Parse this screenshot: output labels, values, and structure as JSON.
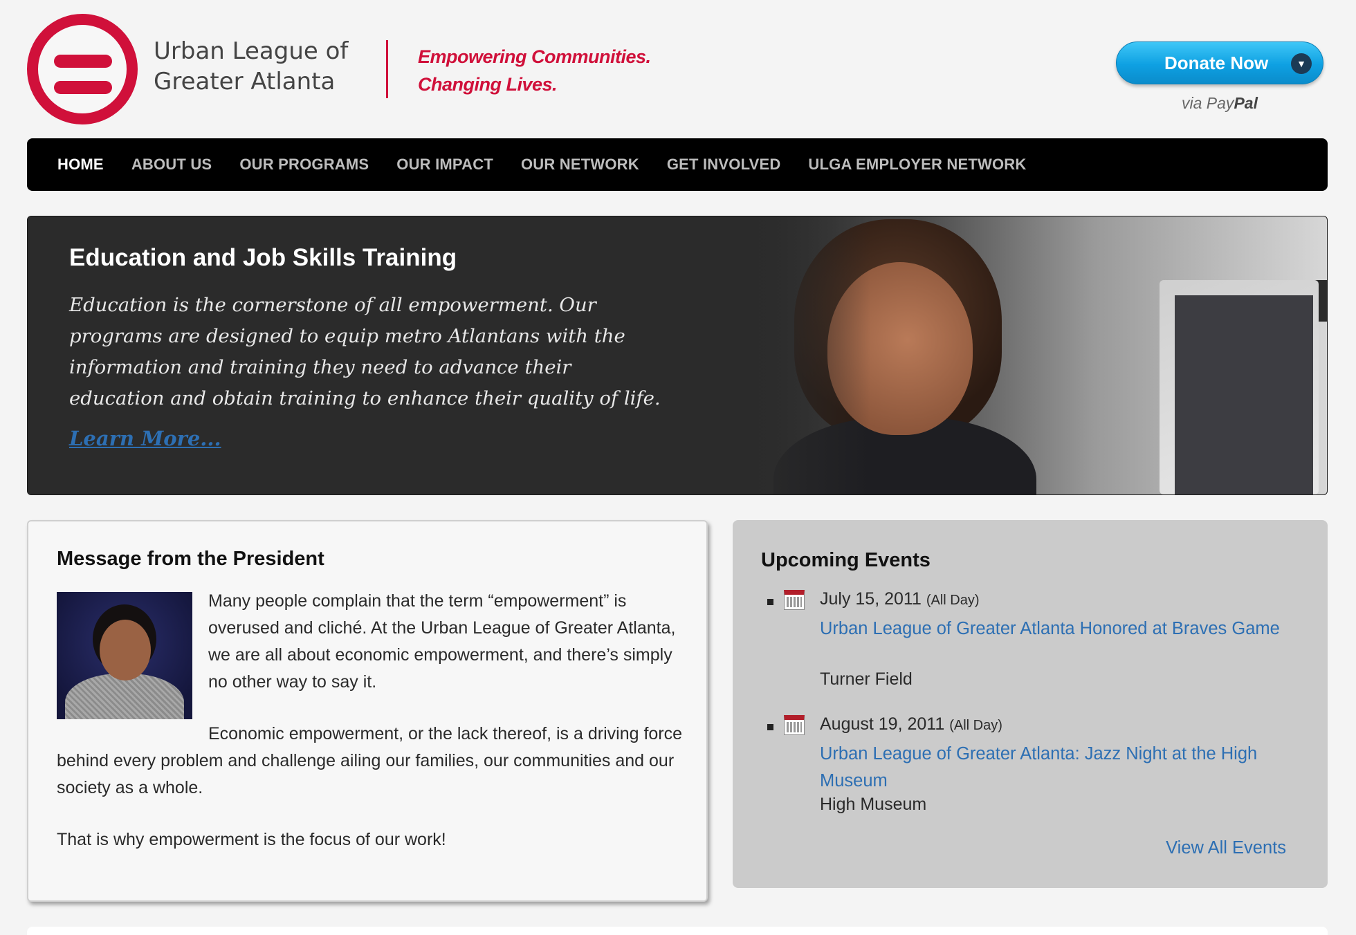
{
  "brand": {
    "name_line1": "Urban League of",
    "name_line2": "Greater Atlanta",
    "tagline_line1": "Empowering Communities.",
    "tagline_line2": "Changing Lives.",
    "color": "#d0103a"
  },
  "donate": {
    "label": "Donate Now",
    "via": "via Pay",
    "via_brand": "Pal"
  },
  "nav": {
    "items": [
      {
        "label": "HOME",
        "active": true
      },
      {
        "label": "ABOUT US"
      },
      {
        "label": "OUR PROGRAMS"
      },
      {
        "label": "OUR IMPACT"
      },
      {
        "label": "OUR NETWORK"
      },
      {
        "label": "GET INVOLVED"
      },
      {
        "label": "ULGA EMPLOYER NETWORK"
      }
    ]
  },
  "hero": {
    "title": "Education and Job Skills Training",
    "text": "Education is the cornerstone of all empowerment. Our programs are designed to equip metro Atlantans with the information and training they need to advance their education and obtain training to enhance their quality of life.",
    "link": "Learn More..."
  },
  "president": {
    "title": "Message from the President",
    "p1": "Many people complain that the term “empowerment” is overused and cliché. At the Urban League of Greater Atlanta, we are all about economic empowerment, and there’s simply no other way to say it.",
    "p2": "Economic empowerment, or the lack thereof, is a driving force behind every problem and challenge ailing our families, our communities and our society as a whole.",
    "p3": "That is why empowerment is the focus of our work!"
  },
  "events": {
    "title": "Upcoming Events",
    "items": [
      {
        "date": "July 15, 2011",
        "all_day": "(All Day)",
        "title": "Urban League of Greater Atlanta Honored at Braves Game",
        "venue": "Turner Field"
      },
      {
        "date": "August 19, 2011",
        "all_day": "(All Day)",
        "title": "Urban League of Greater Atlanta: Jazz Night at the High Museum",
        "venue": "High Museum"
      }
    ],
    "view_all": "View All Events"
  }
}
